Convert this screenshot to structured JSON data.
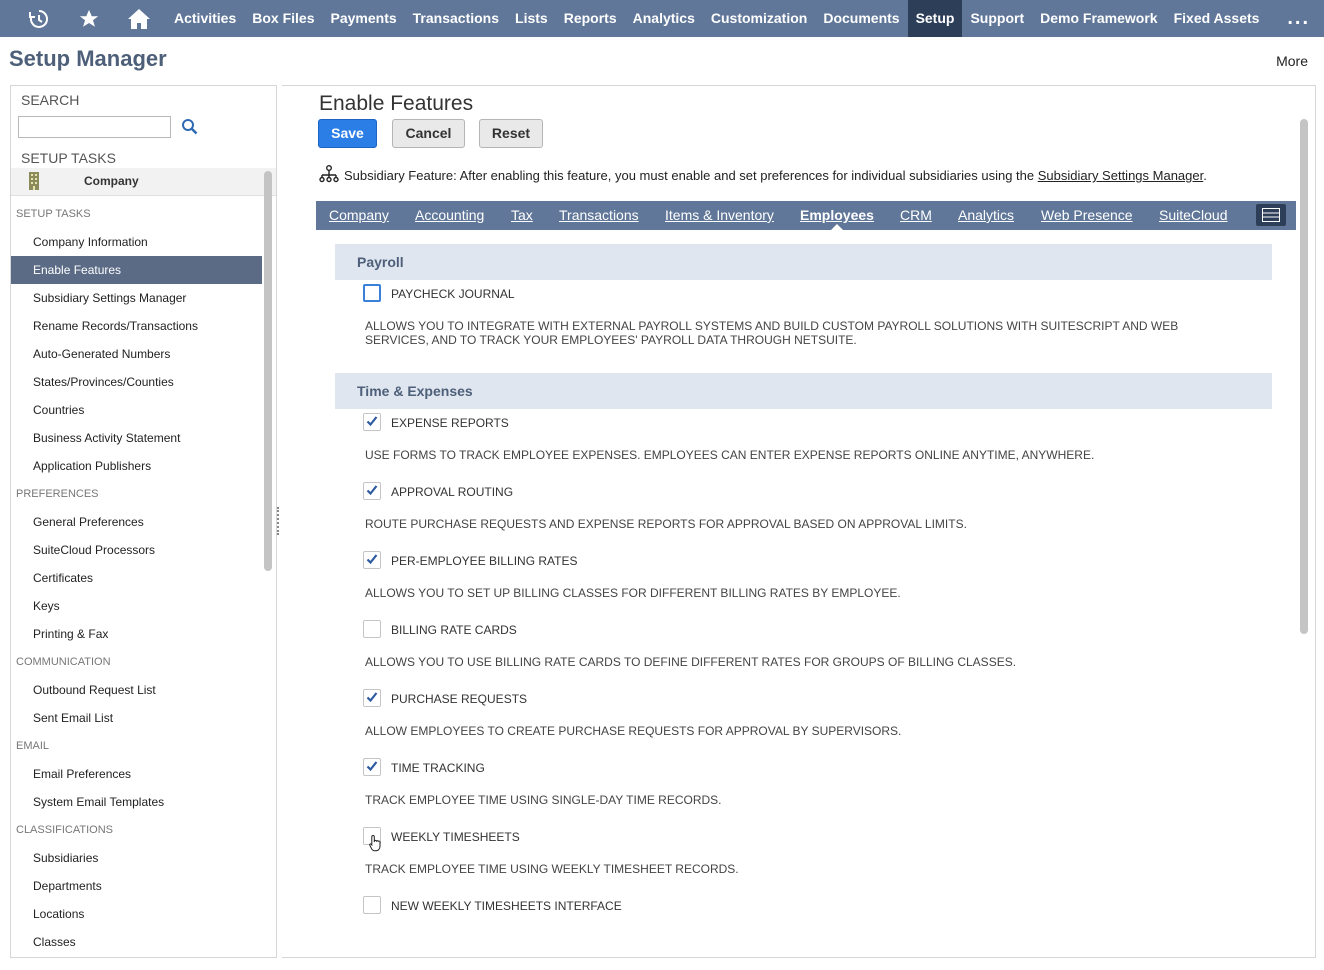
{
  "topnav": {
    "items": [
      "Activities",
      "Box Files",
      "Payments",
      "Transactions",
      "Lists",
      "Reports",
      "Analytics",
      "Customization",
      "Documents",
      "Setup",
      "Support",
      "Demo Framework",
      "Fixed Assets"
    ],
    "active": "Setup",
    "more": "..."
  },
  "header": {
    "title": "Setup Manager",
    "more": "More"
  },
  "sidebar": {
    "search_label": "SEARCH",
    "setup_tasks_title": "SETUP TASKS",
    "company_label": "Company",
    "sections": [
      {
        "title": "SETUP TASKS",
        "items": [
          "Company Information",
          "Enable Features",
          "Subsidiary Settings Manager",
          "Rename Records/Transactions",
          "Auto-Generated Numbers",
          "States/Provinces/Counties",
          "Countries",
          "Business Activity Statement",
          "Application Publishers"
        ]
      },
      {
        "title": "PREFERENCES",
        "items": [
          "General Preferences",
          "SuiteCloud Processors",
          "Certificates",
          "Keys",
          "Printing & Fax"
        ]
      },
      {
        "title": "COMMUNICATION",
        "items": [
          "Outbound Request List",
          "Sent Email List"
        ]
      },
      {
        "title": "EMAIL",
        "items": [
          "Email Preferences",
          "System Email Templates"
        ]
      },
      {
        "title": "CLASSIFICATIONS",
        "items": [
          "Subsidiaries",
          "Departments",
          "Locations",
          "Classes"
        ]
      }
    ],
    "active_item": "Enable Features"
  },
  "main": {
    "title": "Enable Features",
    "save": "Save",
    "cancel": "Cancel",
    "reset": "Reset",
    "note_text": "Subsidiary Feature: After enabling this feature, you must enable and set preferences for individual subsidiaries using the ",
    "note_link": "Subsidiary Settings Manager",
    "note_end": ".",
    "tabs": [
      "Company",
      "Accounting",
      "Tax",
      "Transactions",
      "Items & Inventory",
      "Employees",
      "CRM",
      "Analytics",
      "Web Presence",
      "SuiteCloud"
    ],
    "active_tab": "Employees",
    "payroll": {
      "title": "Payroll",
      "features": [
        {
          "label": "PAYCHECK JOURNAL",
          "checked": false,
          "desc": "ALLOWS YOU TO INTEGRATE WITH EXTERNAL PAYROLL SYSTEMS AND BUILD CUSTOM PAYROLL SOLUTIONS WITH SUITESCRIPT AND WEB SERVICES, AND TO TRACK YOUR EMPLOYEES' PAYROLL DATA THROUGH NETSUITE."
        }
      ]
    },
    "time_expenses": {
      "title": "Time & Expenses",
      "features": [
        {
          "label": "EXPENSE REPORTS",
          "checked": true,
          "desc": "USE FORMS TO TRACK EMPLOYEE EXPENSES. EMPLOYEES CAN ENTER EXPENSE REPORTS ONLINE ANYTIME, ANYWHERE."
        },
        {
          "label": "APPROVAL ROUTING",
          "checked": true,
          "desc": "ROUTE PURCHASE REQUESTS AND EXPENSE REPORTS FOR APPROVAL BASED ON APPROVAL LIMITS."
        },
        {
          "label": "PER-EMPLOYEE BILLING RATES",
          "checked": true,
          "desc": "ALLOWS YOU TO SET UP BILLING CLASSES FOR DIFFERENT BILLING RATES BY EMPLOYEE."
        },
        {
          "label": "BILLING RATE CARDS",
          "checked": false,
          "desc": "ALLOWS YOU TO USE BILLING RATE CARDS TO DEFINE DIFFERENT RATES FOR GROUPS OF BILLING CLASSES."
        },
        {
          "label": "PURCHASE REQUESTS",
          "checked": true,
          "desc": "ALLOW EMPLOYEES TO CREATE PURCHASE REQUESTS FOR APPROVAL BY SUPERVISORS."
        },
        {
          "label": "TIME TRACKING",
          "checked": true,
          "desc": "TRACK EMPLOYEE TIME USING SINGLE-DAY TIME RECORDS."
        },
        {
          "label": "WEEKLY TIMESHEETS",
          "checked": false,
          "desc": "TRACK EMPLOYEE TIME USING WEEKLY TIMESHEET RECORDS."
        },
        {
          "label": "NEW WEEKLY TIMESHEETS INTERFACE",
          "checked": false,
          "desc": ""
        }
      ]
    }
  },
  "colors": {
    "nav": "#607799",
    "nav_active": "#2d3e58",
    "section": "#e0e6ef",
    "save": "#2a7ee6",
    "check": "#2d5aa0"
  }
}
